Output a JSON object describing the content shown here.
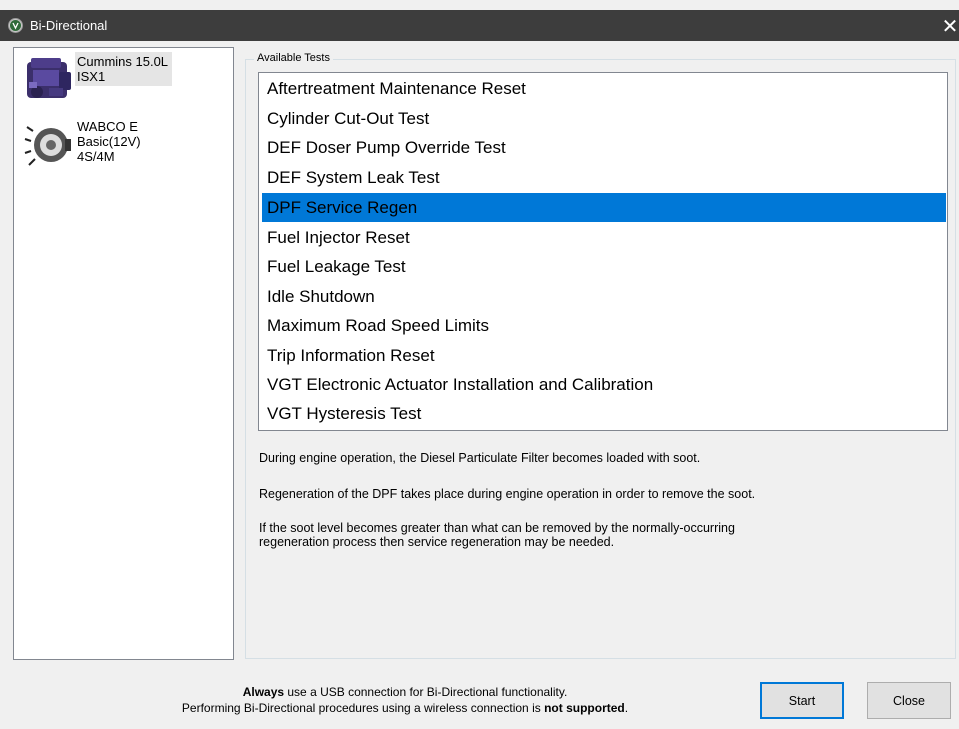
{
  "window": {
    "title": "Bi-Directional",
    "close_glyph": "✕"
  },
  "devices": [
    {
      "label": "Cummins 15.0L\nISX1",
      "icon": "engine-icon",
      "selected": true
    },
    {
      "label": "WABCO E\nBasic(12V)\n4S/4M",
      "icon": "abs-modulator-icon",
      "selected": false
    }
  ],
  "group": {
    "legend": "Available Tests"
  },
  "tests": [
    "Aftertreatment Maintenance Reset",
    "Cylinder Cut-Out Test",
    "DEF Doser Pump Override Test",
    "DEF System Leak Test",
    "DPF Service Regen",
    "Fuel Injector Reset",
    "Fuel Leakage Test",
    "Idle Shutdown",
    "Maximum Road Speed Limits",
    "Trip Information Reset",
    "VGT Electronic Actuator Installation and Calibration",
    "VGT Hysteresis Test"
  ],
  "selected_test": "DPF Service Regen",
  "description": {
    "p1": "During engine operation, the Diesel Particulate Filter becomes loaded with soot.",
    "p2": "Regeneration of the DPF takes place during engine operation in order to remove the soot.",
    "p3_line1": "If the soot level becomes greater than what can be removed by the normally-occurring",
    "p3_line2": "regeneration process then service regeneration may be needed."
  },
  "footer": {
    "line1_bold": "Always",
    "line1_rest": " use a USB connection for Bi-Directional functionality.",
    "line2_pre": "Performing Bi-Directional procedures using a wireless connection is ",
    "line2_bold": "not supported",
    "line2_post": "."
  },
  "buttons": {
    "start": "Start",
    "close": "Close"
  },
  "colors": {
    "selection": "#0078d7",
    "titlebar": "#3d3d3d"
  }
}
